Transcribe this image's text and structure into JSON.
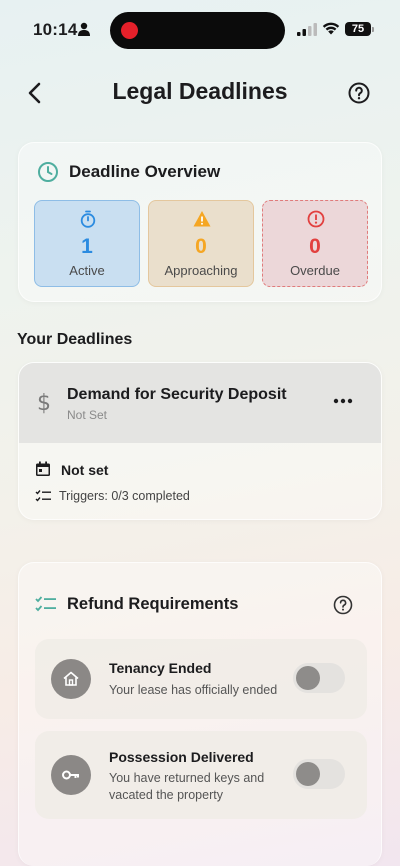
{
  "status_bar": {
    "time": "10:14",
    "battery": "75"
  },
  "header": {
    "title": "Legal Deadlines"
  },
  "overview": {
    "title": "Deadline Overview",
    "stats": [
      {
        "count": "1",
        "label": "Active",
        "color": "#2b8be0"
      },
      {
        "count": "0",
        "label": "Approaching",
        "color": "#f5a623"
      },
      {
        "count": "0",
        "label": "Overdue",
        "color": "#e2403f"
      }
    ]
  },
  "deadlines_section": {
    "title": "Your Deadlines"
  },
  "deadline": {
    "title": "Demand for Security Deposit",
    "status": "Not Set",
    "date": "Not set",
    "triggers": "Triggers: 0/3 completed"
  },
  "refund": {
    "title": "Refund Requirements",
    "items": [
      {
        "title": "Tenancy Ended",
        "description": "Your lease has officially ended",
        "icon": "home-icon",
        "enabled": false
      },
      {
        "title": "Possession Delivered",
        "description": "You have returned keys and vacated the property",
        "icon": "key-icon",
        "enabled": false
      }
    ]
  },
  "colors": {
    "accent_teal": "#4fae9f",
    "toggle_off": "#8e8c8a"
  }
}
